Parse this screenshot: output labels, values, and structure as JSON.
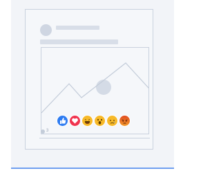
{
  "post": {
    "author_placeholder": "name",
    "reaction_count": "3"
  },
  "reactions": [
    {
      "type": "like",
      "color": "#2d7bf1"
    },
    {
      "type": "love",
      "color": "#f0344f"
    },
    {
      "type": "haha",
      "color": "#f7b928"
    },
    {
      "type": "wow",
      "color": "#f7b928"
    },
    {
      "type": "sad",
      "color": "#f7b928"
    },
    {
      "type": "angry",
      "color": "#e04a1f"
    }
  ],
  "colors": {
    "background": "#f2f4f8",
    "card_border": "#c9d1de",
    "placeholder": "#d8dee8",
    "accent_line": "#6f9ef0"
  }
}
